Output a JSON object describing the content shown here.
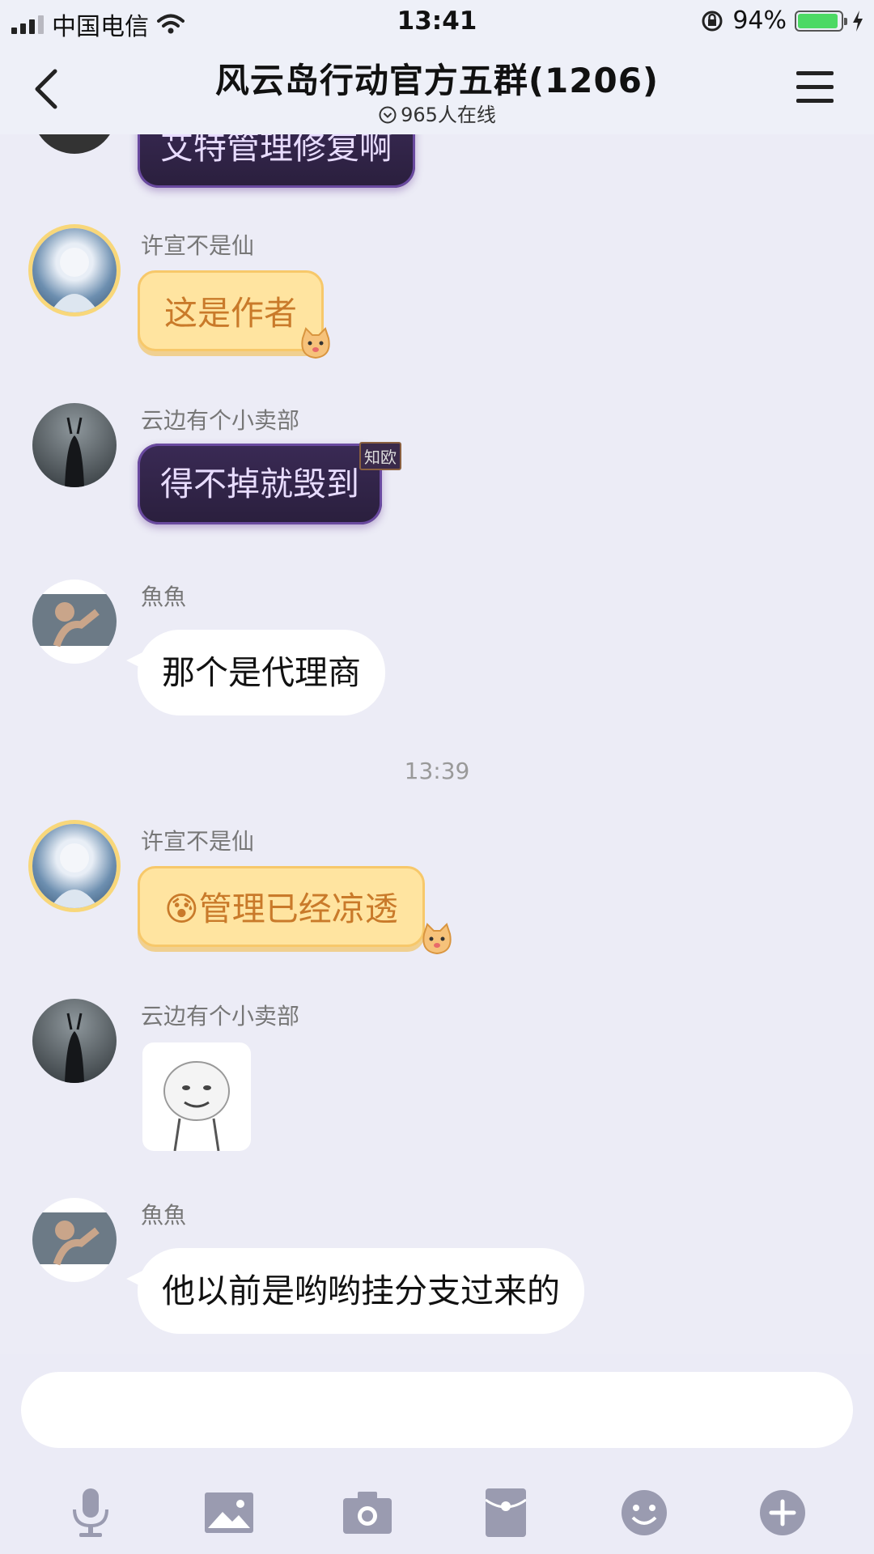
{
  "status_bar": {
    "carrier": "中国电信",
    "time": "13:41",
    "battery": "94%",
    "battery_level": 0.94
  },
  "header": {
    "title": "风云岛行动官方五群(1206)",
    "subtitle": "965人在线"
  },
  "messages": [
    {
      "sender": "",
      "text": "艾特管理修复啊",
      "style": "dark"
    },
    {
      "sender": "许宣不是仙",
      "text": "这是作者",
      "style": "cat"
    },
    {
      "sender": "云边有个小卖部",
      "text": "得不掉就毁到",
      "style": "dark",
      "badge": "知欧"
    },
    {
      "sender": "魚魚",
      "text": "那个是代理商",
      "style": "white"
    },
    {
      "sender": "许宣不是仙",
      "text": "😰管理已经凉透",
      "style": "cat"
    },
    {
      "sender": "云边有个小卖部",
      "text": "",
      "style": "sticker"
    },
    {
      "sender": "魚魚",
      "text": "他以前是哟哟挂分支过来的",
      "style": "white"
    }
  ],
  "time_separator": "13:39",
  "input": {
    "value": "",
    "placeholder": ""
  },
  "toolbar": [
    "microphone-icon",
    "image-icon",
    "camera-icon",
    "red-packet-icon",
    "emoji-icon",
    "plus-icon"
  ],
  "colors": {
    "background": "#ececf6",
    "cat_bubble": "#ffe4a0",
    "dark_bubble": "#2a1f3d",
    "icon": "#9a9bb0"
  }
}
